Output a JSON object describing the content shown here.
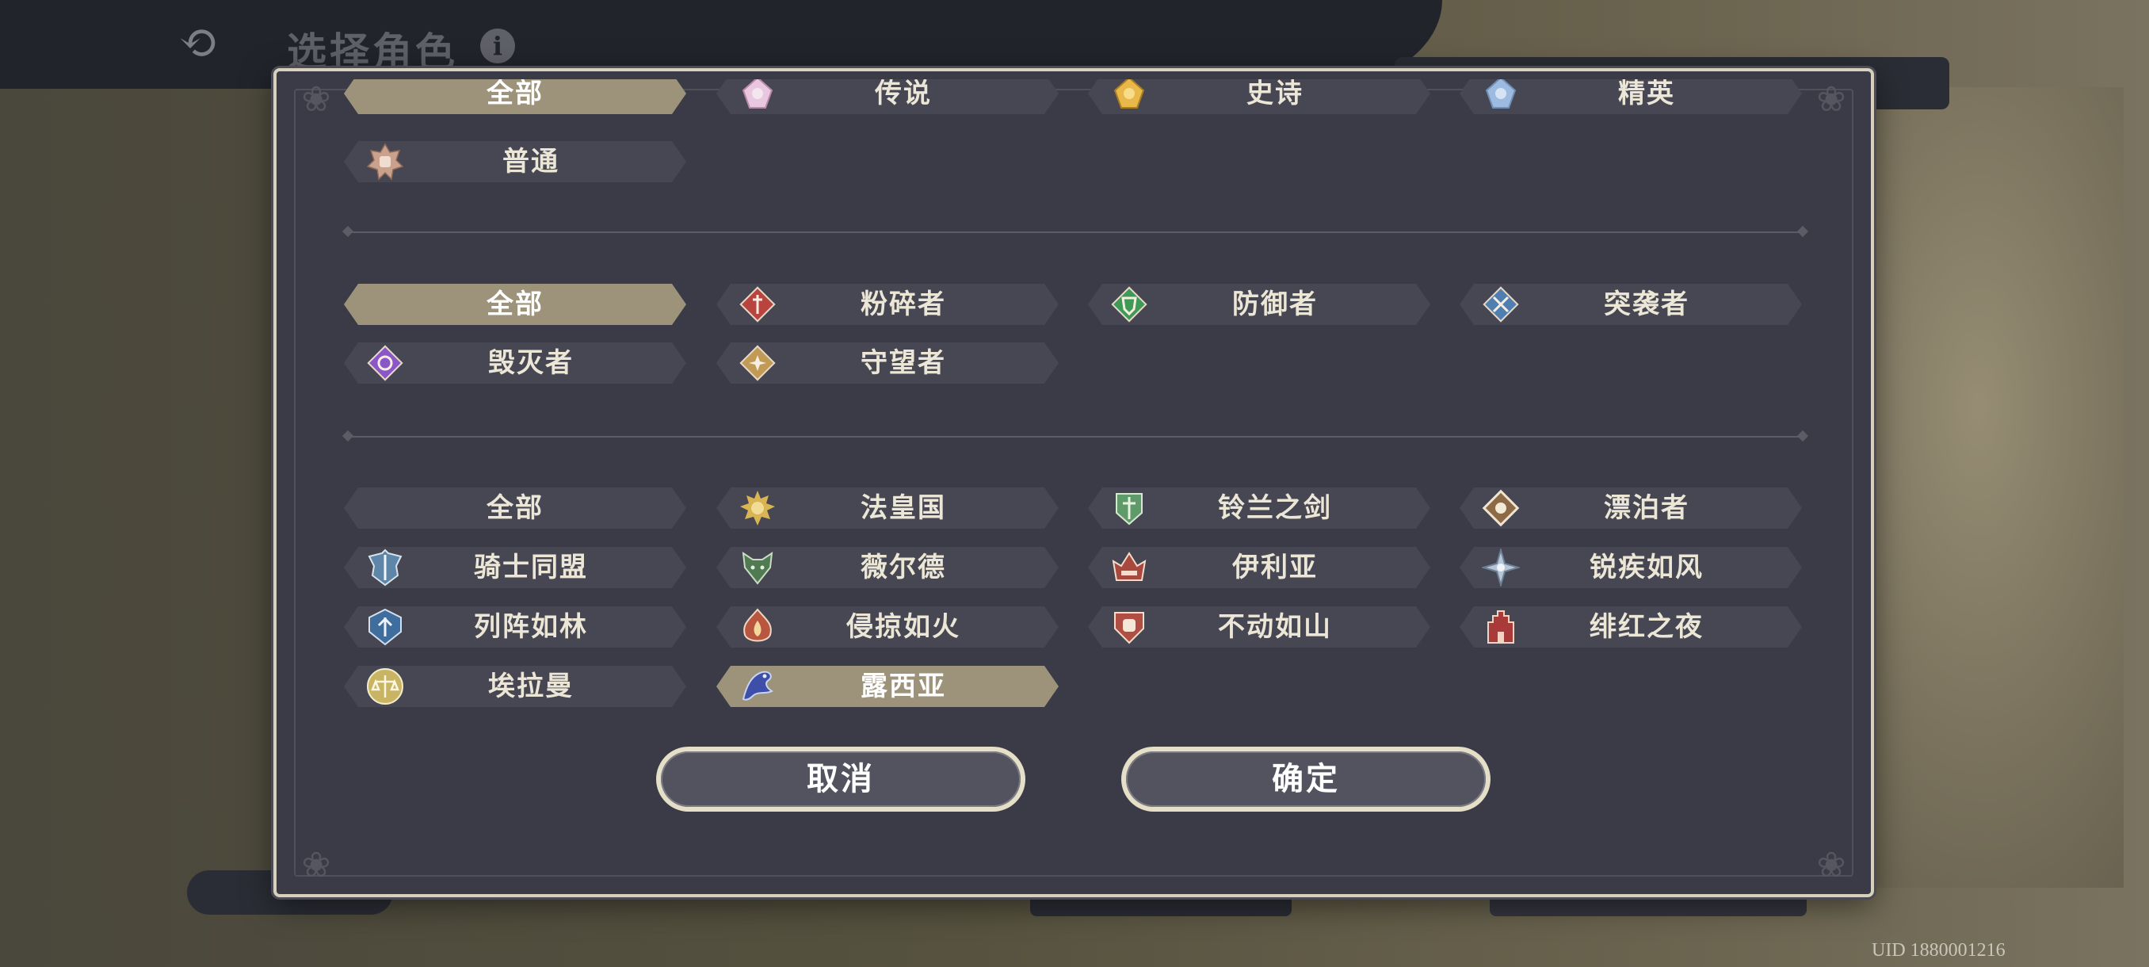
{
  "header": {
    "title": "选择角色",
    "info_glyph": "i",
    "back_icon": "back-arrow-icon"
  },
  "uid": "UID 1880001216",
  "filters": {
    "rarity": [
      {
        "label": "全部",
        "selected": true,
        "icon": null
      },
      {
        "label": "传说",
        "selected": false,
        "icon": "legendary-icon"
      },
      {
        "label": "史诗",
        "selected": false,
        "icon": "epic-icon"
      },
      {
        "label": "精英",
        "selected": false,
        "icon": "elite-icon"
      },
      {
        "label": "普通",
        "selected": false,
        "icon": "common-icon"
      }
    ],
    "class": [
      {
        "label": "全部",
        "selected": true,
        "icon": null
      },
      {
        "label": "粉碎者",
        "selected": false,
        "icon": "crusher-icon"
      },
      {
        "label": "防御者",
        "selected": false,
        "icon": "defender-icon"
      },
      {
        "label": "突袭者",
        "selected": false,
        "icon": "raider-icon"
      },
      {
        "label": "毁灭者",
        "selected": false,
        "icon": "destroyer-icon"
      },
      {
        "label": "守望者",
        "selected": false,
        "icon": "watcher-icon"
      }
    ],
    "faction": [
      {
        "label": "全部",
        "selected": false,
        "icon": null
      },
      {
        "label": "法皇国",
        "selected": false,
        "icon": "sun-emblem-icon"
      },
      {
        "label": "铃兰之剑",
        "selected": false,
        "icon": "lily-sword-icon"
      },
      {
        "label": "漂泊者",
        "selected": false,
        "icon": "wanderer-icon"
      },
      {
        "label": "骑士同盟",
        "selected": false,
        "icon": "knight-alliance-icon"
      },
      {
        "label": "薇尔德",
        "selected": false,
        "icon": "wolf-head-icon"
      },
      {
        "label": "伊利亚",
        "selected": false,
        "icon": "crown-icon"
      },
      {
        "label": "锐疾如风",
        "selected": false,
        "icon": "wind-star-icon"
      },
      {
        "label": "列阵如林",
        "selected": false,
        "icon": "forest-shield-icon"
      },
      {
        "label": "侵掠如火",
        "selected": false,
        "icon": "fire-emblem-icon"
      },
      {
        "label": "不动如山",
        "selected": false,
        "icon": "fist-shield-icon"
      },
      {
        "label": "绯红之夜",
        "selected": false,
        "icon": "red-castle-icon"
      },
      {
        "label": "埃拉曼",
        "selected": false,
        "icon": "scales-icon"
      },
      {
        "label": "露西亚",
        "selected": true,
        "icon": "dragon-icon"
      }
    ]
  },
  "buttons": {
    "cancel": "取消",
    "confirm": "确定"
  },
  "colors": {
    "chip": "#464753",
    "chip_selected": "#9d927a",
    "dialog": "#3a3b46",
    "border": "#d7d1bc"
  }
}
